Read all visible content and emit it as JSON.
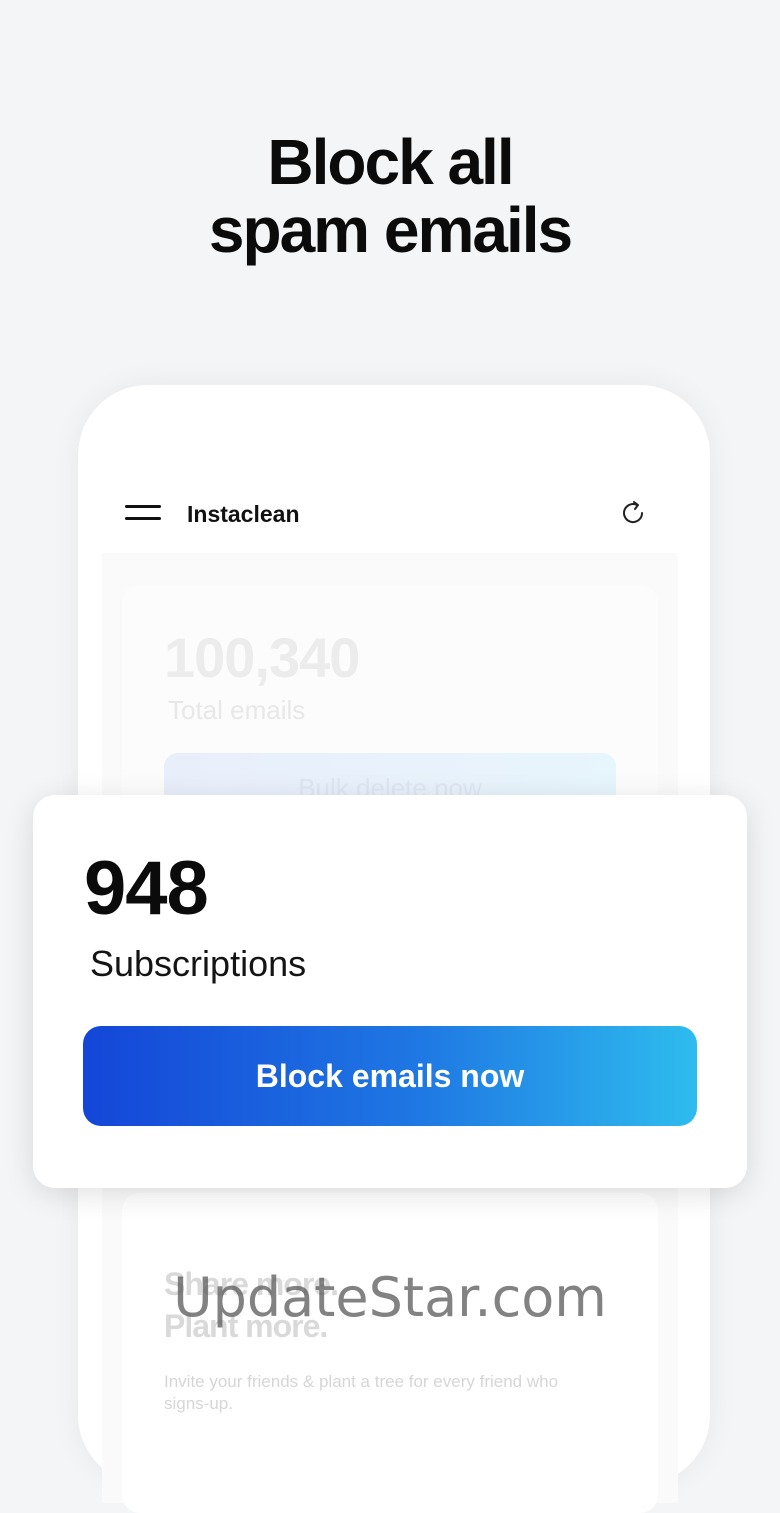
{
  "headline": {
    "line1": "Block all",
    "line2": "spam emails"
  },
  "app": {
    "title": "Instaclean",
    "menu_icon": "hamburger-menu-icon",
    "refresh_icon": "refresh-icon"
  },
  "background_card": {
    "total_count": "100,340",
    "total_label": "Total emails",
    "bulk_button_label": "Bulk delete now"
  },
  "subscriptions_card": {
    "count": "948",
    "label": "Subscriptions",
    "button_label": "Block emails now",
    "button_gradient": [
      "#1446d8",
      "#2ebcee"
    ]
  },
  "share_card": {
    "line1": "Share more.",
    "line2": "Plant more.",
    "invite_text": "Invite your friends & plant a tree for every friend who signs-up."
  },
  "watermark": "UpdateStar.com"
}
